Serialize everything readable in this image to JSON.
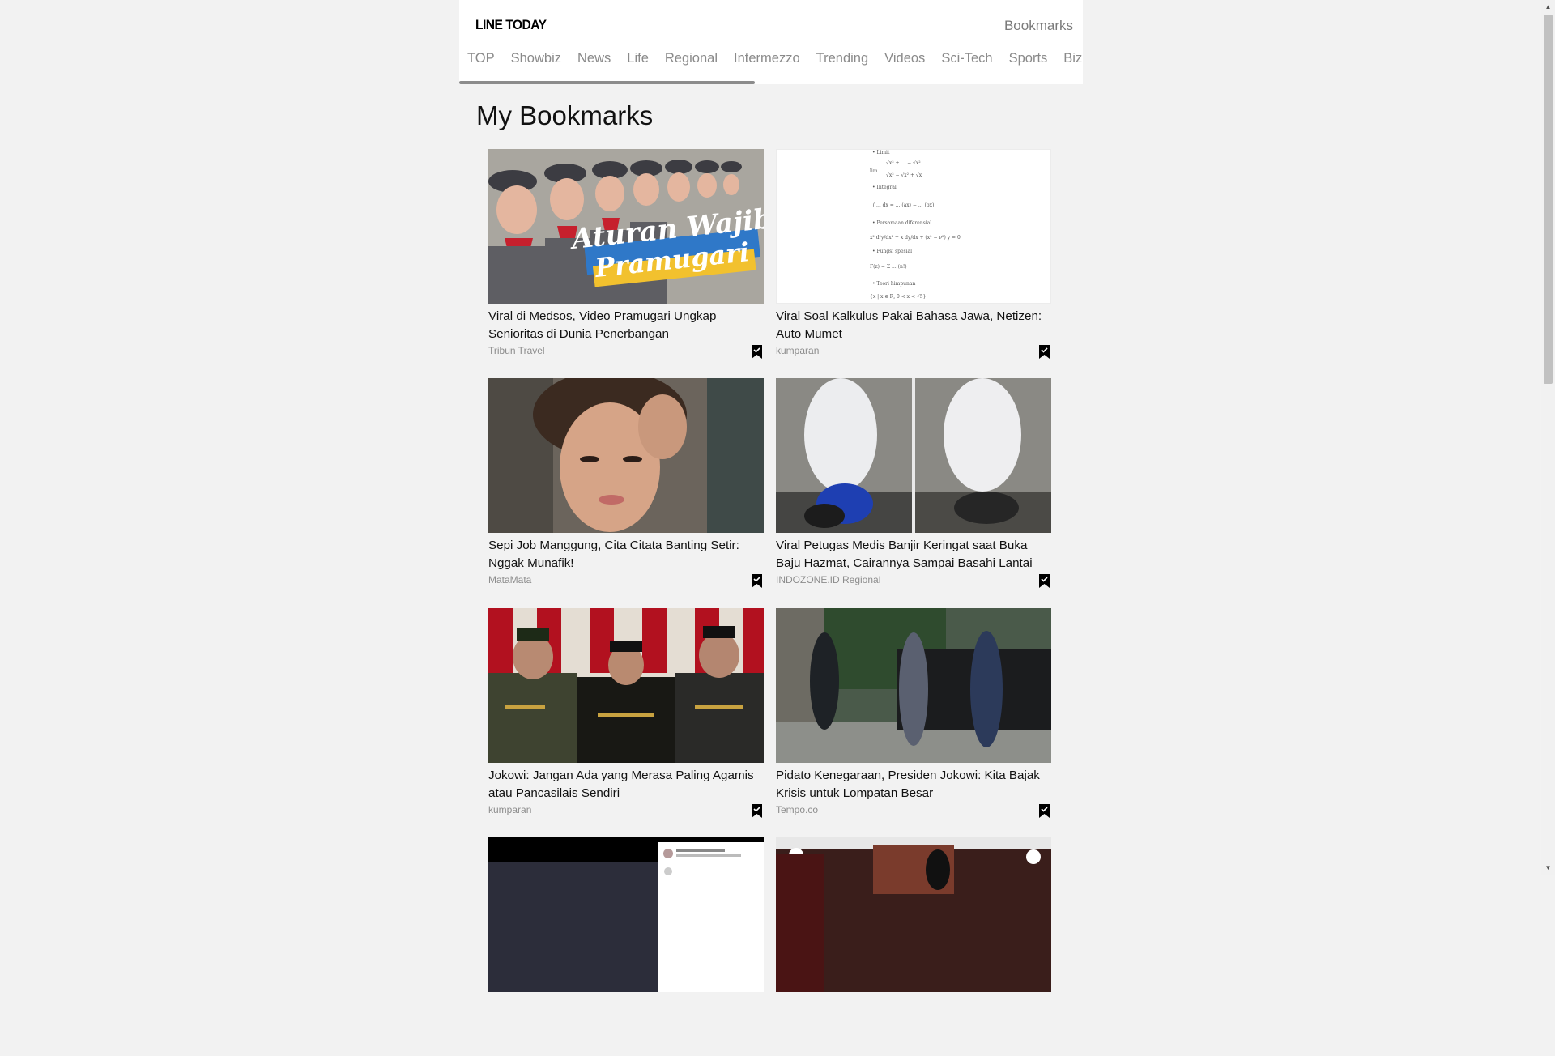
{
  "header": {
    "logo": "LINE TODAY",
    "bookmarks_link": "Bookmarks"
  },
  "tabs": [
    "TOP",
    "Showbiz",
    "News",
    "Life",
    "Regional",
    "Intermezzo",
    "Trending",
    "Videos",
    "Sci-Tech",
    "Sports",
    "Biz"
  ],
  "page_title": "My Bookmarks",
  "articles": [
    {
      "title": "Viral di Medsos, Video Pramugari Ungkap Senioritas di Dunia Penerbangan",
      "source": "Tribun Travel",
      "thumb_text": "Aturan Wajib Pramugari"
    },
    {
      "title": "Viral Soal Kalkulus Pakai Bahasa Jawa, Netizen: Auto Mumet",
      "source": "kumparan"
    },
    {
      "title": "Sepi Job Manggung, Cita Citata Banting Setir: Nggak Munafik!",
      "source": "MataMata"
    },
    {
      "title": "Viral Petugas Medis Banjir Keringat saat Buka Baju Hazmat, Cairannya Sampai Basahi Lantai",
      "source": "INDOZONE.ID Regional"
    },
    {
      "title": "Jokowi: Jangan Ada yang Merasa Paling Agamis atau Pancasilais Sendiri",
      "source": "kumparan"
    },
    {
      "title": "Pidato Kenegaraan, Presiden Jokowi: Kita Bajak Krisis untuk Lompatan Besar",
      "source": "Tempo.co"
    },
    {
      "title": "",
      "source": ""
    },
    {
      "title": "",
      "source": ""
    }
  ],
  "icons": {
    "bookmark": "bookmark-filled-icon"
  },
  "colors": {
    "background": "#f2f2f2",
    "header_bg": "#ffffff",
    "tab_text": "#8a8a8a",
    "source_text": "#8d8d8d"
  }
}
